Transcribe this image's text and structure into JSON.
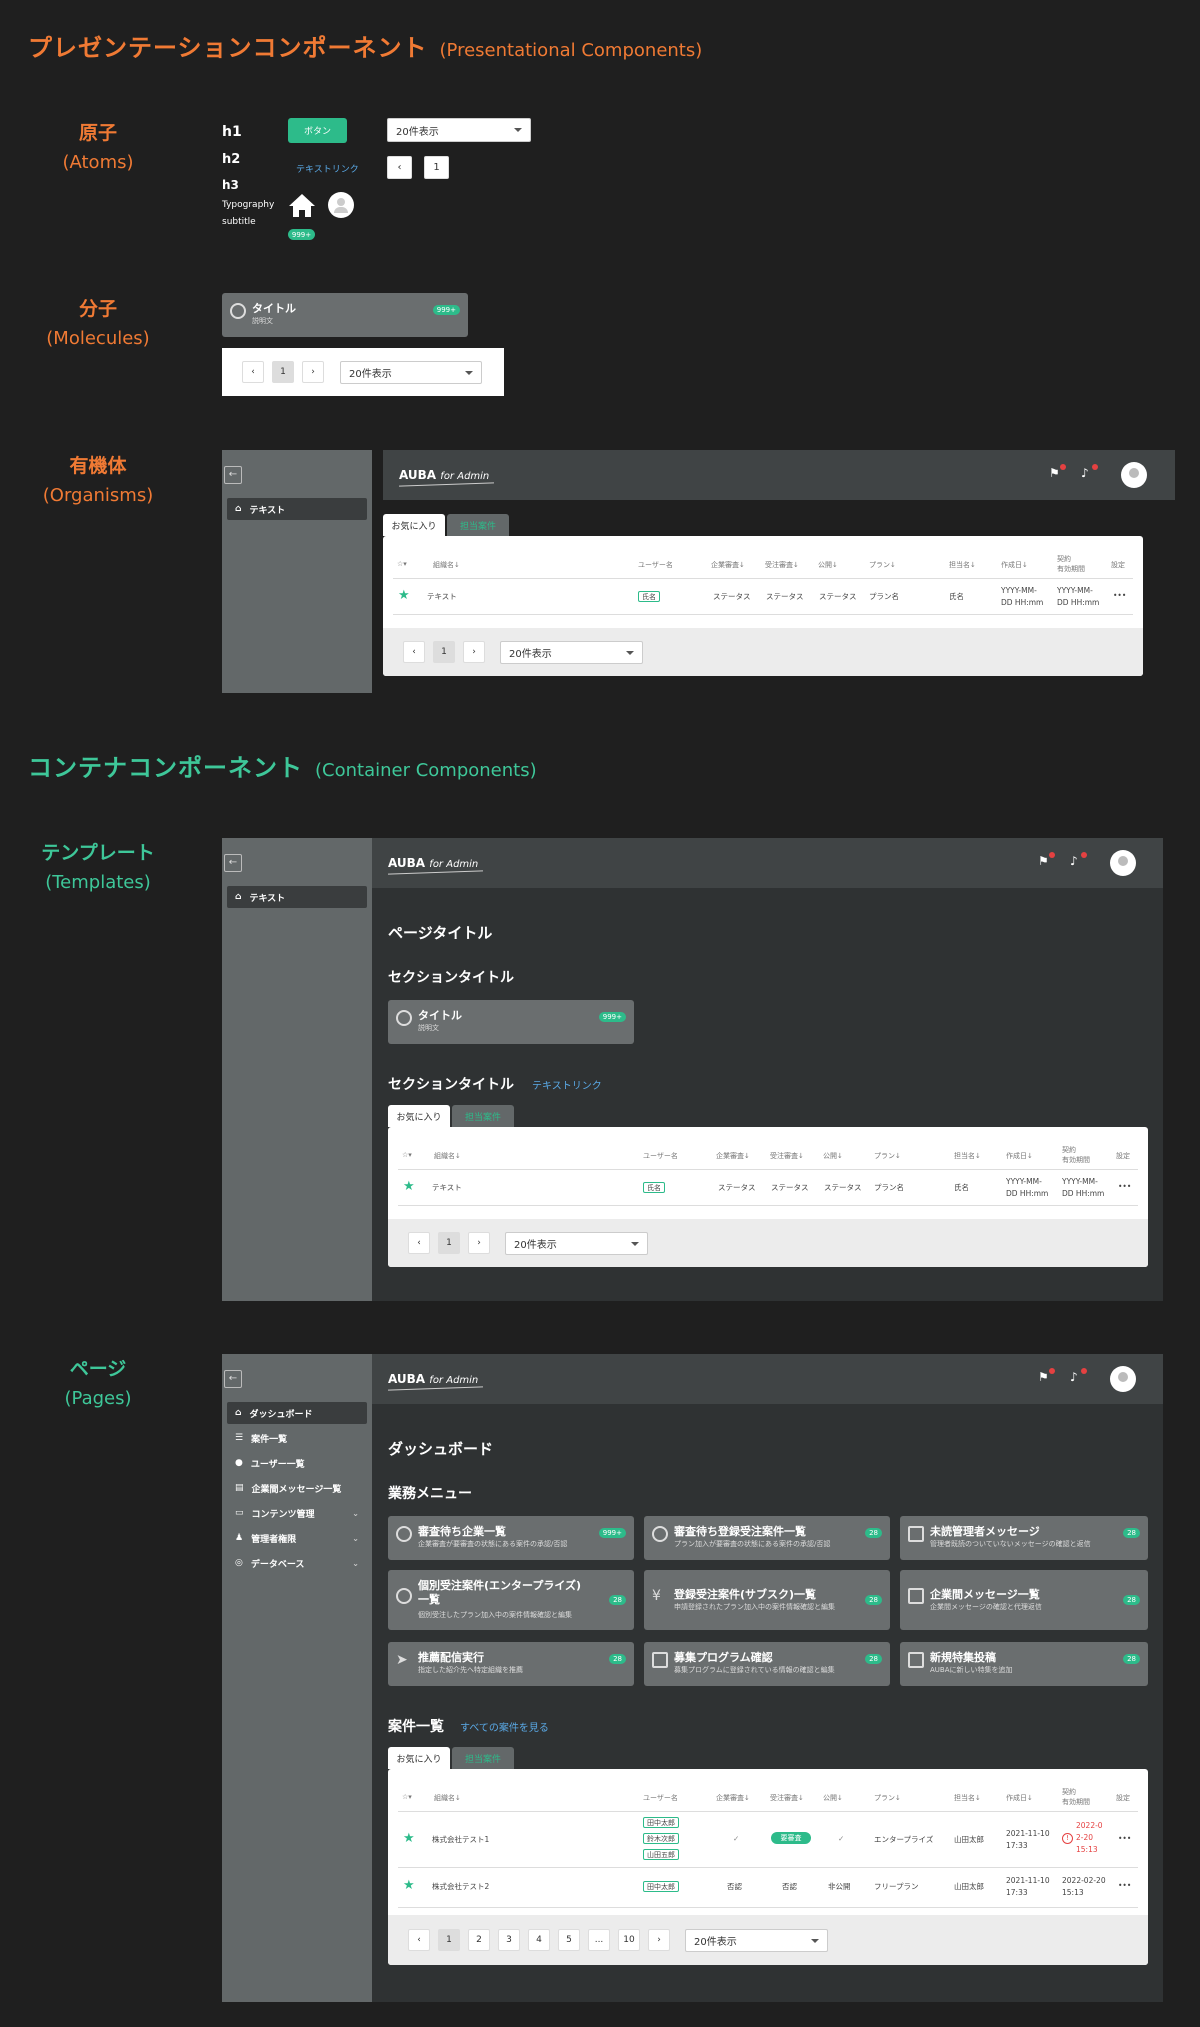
{
  "presentational": {
    "title": "プレゼンテーションコンポーネント",
    "subtitle": "(Presentational Components)"
  },
  "container": {
    "title": "コンテナコンポーネント",
    "subtitle": "(Container Components)"
  },
  "levels": {
    "atoms": {
      "jp": "原子",
      "en": "(Atoms)"
    },
    "molecules": {
      "jp": "分子",
      "en": "(Molecules)"
    },
    "organisms": {
      "jp": "有機体",
      "en": "(Organisms)"
    },
    "templates": {
      "jp": "テンプレート",
      "en": "(Templates)"
    },
    "pages": {
      "jp": "ページ",
      "en": "(Pages)"
    }
  },
  "atoms": {
    "h1": "h1",
    "h2": "h2",
    "h3": "h3",
    "typo1": "Typography",
    "typo2": "subtitle",
    "button": "ボタン",
    "link": "テキストリンク",
    "badge": "999+",
    "select": "20件表示",
    "page": "1"
  },
  "molecule": {
    "card_title": "タイトル",
    "card_desc": "説明文",
    "badge": "999+",
    "select": "20件表示",
    "page": "1"
  },
  "common": {
    "logo": "AUBA",
    "logo_sub": "for Admin",
    "nav_text": "テキスト",
    "tab_fav": "お気に入り",
    "tab_mine": "担当案件",
    "col_org": "組織名↓",
    "col_user": "ユーザー名",
    "col_comp": "企業審査↓",
    "col_order": "受注審査↓",
    "col_pub": "公開↓",
    "col_plan": "プラン↓",
    "col_owner": "担当名↓",
    "col_created": "作成日↓",
    "col_contract1": "契約",
    "col_contract2": "有効期間",
    "col_settings": "設定",
    "row_org": "テキスト",
    "row_user": "氏名",
    "row_status": "ステータス",
    "row_plan": "プラン名",
    "row_owner": "氏名",
    "row_date1": "YYYY-MM-",
    "row_date2": "DD HH:mm",
    "row_more": "•••",
    "select": "20件表示",
    "page": "1"
  },
  "templates": {
    "page_title": "ページタイトル",
    "section1": "セクションタイトル",
    "section2": "セクションタイトル",
    "link": "テキストリンク",
    "card_title": "タイトル",
    "card_desc": "説明文",
    "badge": "999+"
  },
  "pages": {
    "nav": [
      "ダッシュボード",
      "案件一覧",
      "ユーザー一覧",
      "企業間メッセージ一覧",
      "コンテンツ管理",
      "管理者権限",
      "データベース"
    ],
    "page_title": "ダッシュボード",
    "menu_title": "業務メニュー",
    "menu": [
      {
        "title": "審査待ち企業一覧",
        "desc": "企業審査が要審査の状態にある案件の承認/否認",
        "badge": "999+"
      },
      {
        "title": "審査待ち登録受注案件一覧",
        "desc": "プラン加入が要審査の状態にある案件の承認/否認",
        "badge": "28"
      },
      {
        "title": "未読管理者メッセージ",
        "desc": "管理者既読のついていないメッセージの確認と返信",
        "badge": "28"
      },
      {
        "title": "個別受注案件(エンタープライズ)",
        "title2": "一覧",
        "desc": "個別受注したプラン加入中の案件情報確認と編集",
        "badge": "28"
      },
      {
        "title": "登録受注案件(サブスク)一覧",
        "desc": "申請登録されたプラン加入中の案件情報確認と編集",
        "badge": "28"
      },
      {
        "title": "企業間メッセージ一覧",
        "desc": "企業間メッセージの確認と代理返信",
        "badge": "28"
      },
      {
        "title": "推薦配信実行",
        "desc": "指定した紹介先へ特定組織を推薦",
        "badge": "28"
      },
      {
        "title": "募集プログラム確認",
        "desc": "募集プログラムに登録されている情報の確認と編集",
        "badge": "28"
      },
      {
        "title": "新規特集投稿",
        "desc": "AUBAに新しい特集を追加",
        "badge": "28"
      }
    ],
    "list_title": "案件一覧",
    "list_link": "すべての案件を見る",
    "rows": [
      {
        "org": "株式会社テスト1",
        "users": [
          "田中太郎",
          "鈴木次郎",
          "山田五郎"
        ],
        "comp": "✓",
        "order": "要審査",
        "pub": "✓",
        "plan": "エンタープライズ",
        "owner": "山田太郎",
        "created1": "2021-11-10",
        "created2": "17:33",
        "contract1": "2022-0",
        "contract2": "2-20",
        "contract3": "15:13"
      },
      {
        "org": "株式会社テスト2",
        "users": [
          "田中太郎"
        ],
        "comp": "否認",
        "order": "否認",
        "pub": "非公開",
        "plan": "フリープラン",
        "owner": "山田太郎",
        "created1": "2021-11-10",
        "created2": "17:33",
        "contract1": "2022-02-20",
        "contract2": "15:13"
      }
    ],
    "pages": [
      "1",
      "2",
      "3",
      "4",
      "5",
      "...",
      "10"
    ],
    "select": "20件表示"
  },
  "colors": {
    "accent": "#2dbb8a",
    "orange": "#f07a34",
    "link": "#5aa9e6",
    "background": "#1f1f1f"
  }
}
